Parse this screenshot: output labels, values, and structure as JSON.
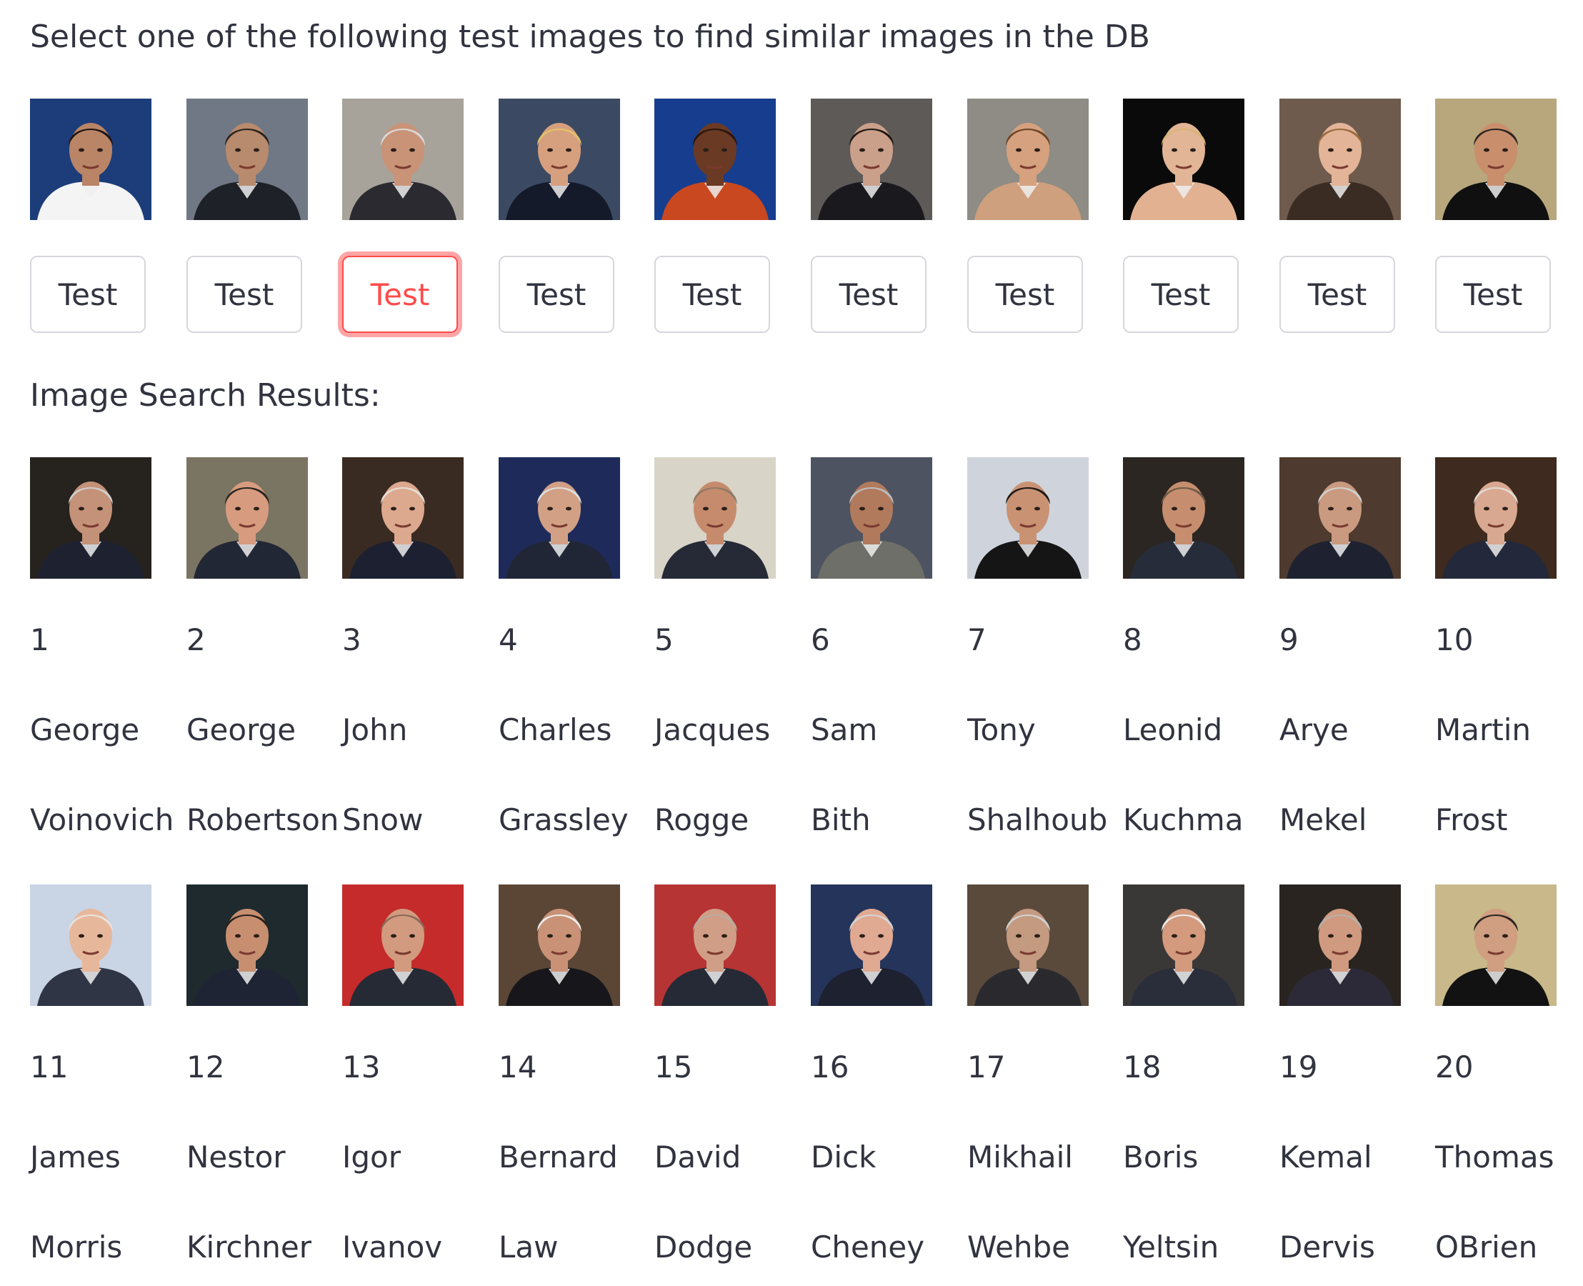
{
  "header": {
    "instruction": "Select one of the following test images to find similar images in the DB"
  },
  "test_images": [
    {
      "button_label": "Test",
      "palette": {
        "bg": "#1c3d7a",
        "skin": "#b98566",
        "hair": "#1e140f",
        "shirt": "#f4f4f4"
      }
    },
    {
      "button_label": "Test",
      "palette": {
        "bg": "#6f7884",
        "skin": "#b88a6e",
        "hair": "#2a221c",
        "shirt": "#1f2128"
      }
    },
    {
      "button_label": "Test",
      "palette": {
        "bg": "#a7a39b",
        "skin": "#c99378",
        "hair": "#d9d9d9",
        "shirt": "#2a2a30"
      }
    },
    {
      "button_label": "Test",
      "palette": {
        "bg": "#3b4a62",
        "skin": "#d6a07f",
        "hair": "#e4c36a",
        "shirt": "#141a2a"
      }
    },
    {
      "button_label": "Test",
      "palette": {
        "bg": "#163d8e",
        "skin": "#6a3a24",
        "hair": "#2a140c",
        "shirt": "#c9481f"
      }
    },
    {
      "button_label": "Test",
      "palette": {
        "bg": "#5d5a58",
        "skin": "#caa08a",
        "hair": "#201612",
        "shirt": "#1a1a1e"
      }
    },
    {
      "button_label": "Test",
      "palette": {
        "bg": "#8e8c84",
        "skin": "#d6a17f",
        "hair": "#6b4425",
        "shirt": "#cfa07e"
      }
    },
    {
      "button_label": "Test",
      "palette": {
        "bg": "#0a0a0a",
        "skin": "#e2b596",
        "hair": "#d7b574",
        "shirt": "#e1b191"
      }
    },
    {
      "button_label": "Test",
      "palette": {
        "bg": "#6e5b4d",
        "skin": "#e3b497",
        "hair": "#9a6a3f",
        "shirt": "#3a2c22"
      }
    },
    {
      "button_label": "Test",
      "palette": {
        "bg": "#b8a77c",
        "skin": "#c98f6d",
        "hair": "#2a2420",
        "shirt": "#101010"
      }
    }
  ],
  "selected_test_index": 2,
  "results_heading": "Image Search Results:",
  "results": [
    {
      "rank": "1",
      "first": "George",
      "last": "Voinovich",
      "palette": {
        "bg": "#26221e",
        "skin": "#c49278",
        "hair": "#cfcfcf",
        "shirt": "#1e2230"
      }
    },
    {
      "rank": "2",
      "first": "George",
      "last": "Robertson",
      "palette": {
        "bg": "#7a7462",
        "skin": "#d79c7f",
        "hair": "#2a2421",
        "shirt": "#222735"
      }
    },
    {
      "rank": "3",
      "first": "John",
      "last": "Snow",
      "palette": {
        "bg": "#3a2b22",
        "skin": "#dca98f",
        "hair": "#e6dfd6",
        "shirt": "#1c2030"
      }
    },
    {
      "rank": "4",
      "first": "Charles",
      "last": "Grassley",
      "palette": {
        "bg": "#1e2b5a",
        "skin": "#d2a085",
        "hair": "#dfdfdf",
        "shirt": "#202636"
      }
    },
    {
      "rank": "5",
      "first": "Jacques",
      "last": "Rogge",
      "palette": {
        "bg": "#d8d4c8",
        "skin": "#c68b6c",
        "hair": "#8c7a68",
        "shirt": "#262a36"
      }
    },
    {
      "rank": "6",
      "first": "Sam",
      "last": "Bith",
      "palette": {
        "bg": "#4d5360",
        "skin": "#b27a5c",
        "hair": "#bcbcbc",
        "shirt": "#6e6f68"
      }
    },
    {
      "rank": "7",
      "first": "Tony",
      "last": "Shalhoub",
      "palette": {
        "bg": "#cfd4dc",
        "skin": "#c99273",
        "hair": "#1c1815",
        "shirt": "#151515"
      }
    },
    {
      "rank": "8",
      "first": "Leonid",
      "last": "Kuchma",
      "palette": {
        "bg": "#2c2622",
        "skin": "#c68e6e",
        "hair": "#6e5a48",
        "shirt": "#272c3a"
      }
    },
    {
      "rank": "9",
      "first": "Arye",
      "last": "Mekel",
      "palette": {
        "bg": "#4e3a2e",
        "skin": "#c99a80",
        "hair": "#d0d0d0",
        "shirt": "#1e2230"
      }
    },
    {
      "rank": "10",
      "first": "Martin",
      "last": "Frost",
      "palette": {
        "bg": "#3e2a1e",
        "skin": "#d9a890",
        "hair": "#e0dcd6",
        "shirt": "#23283a"
      }
    },
    {
      "rank": "11",
      "first": "James",
      "last": "Morris",
      "palette": {
        "bg": "#c9d4e4",
        "skin": "#e7b79c",
        "hair": "#e8e4dc",
        "shirt": "#2f3544"
      }
    },
    {
      "rank": "12",
      "first": "Nestor",
      "last": "Kirchner",
      "palette": {
        "bg": "#1e2a2e",
        "skin": "#c78f70",
        "hair": "#2a1f1a",
        "shirt": "#1e2434"
      }
    },
    {
      "rank": "13",
      "first": "Igor",
      "last": "Ivanov",
      "palette": {
        "bg": "#c52b2b",
        "skin": "#d29a7e",
        "hair": "#8a6a58",
        "shirt": "#262a34"
      }
    },
    {
      "rank": "14",
      "first": "Bernard",
      "last": "Law",
      "palette": {
        "bg": "#5b4636",
        "skin": "#c99276",
        "hair": "#eeeeee",
        "shirt": "#17171b"
      }
    },
    {
      "rank": "15",
      "first": "David",
      "last": "Dodge",
      "palette": {
        "bg": "#b73434",
        "skin": "#d09e86",
        "hair": "#b8aca0",
        "shirt": "#262a36"
      }
    },
    {
      "rank": "16",
      "first": "Dick",
      "last": "Cheney",
      "palette": {
        "bg": "#25345a",
        "skin": "#e0a992",
        "hair": "#d5d5d5",
        "shirt": "#1d2130"
      }
    },
    {
      "rank": "17",
      "first": "Mikhail",
      "last": "Wehbe",
      "palette": {
        "bg": "#5a4a3c",
        "skin": "#c49a80",
        "hair": "#d2d2d2",
        "shirt": "#2a2a2e"
      }
    },
    {
      "rank": "18",
      "first": "Boris",
      "last": "Yeltsin",
      "palette": {
        "bg": "#3a3836",
        "skin": "#d39a7e",
        "hair": "#ececec",
        "shirt": "#2a2e3a"
      }
    },
    {
      "rank": "19",
      "first": "Kemal",
      "last": "Dervis",
      "palette": {
        "bg": "#2a2420",
        "skin": "#cf9a80",
        "hair": "#b8b0a8",
        "shirt": "#2c2a38"
      }
    },
    {
      "rank": "20",
      "first": "Thomas",
      "last": "OBrien",
      "palette": {
        "bg": "#c8b88a",
        "skin": "#d09e80",
        "hair": "#2a2420",
        "shirt": "#121212"
      }
    }
  ]
}
